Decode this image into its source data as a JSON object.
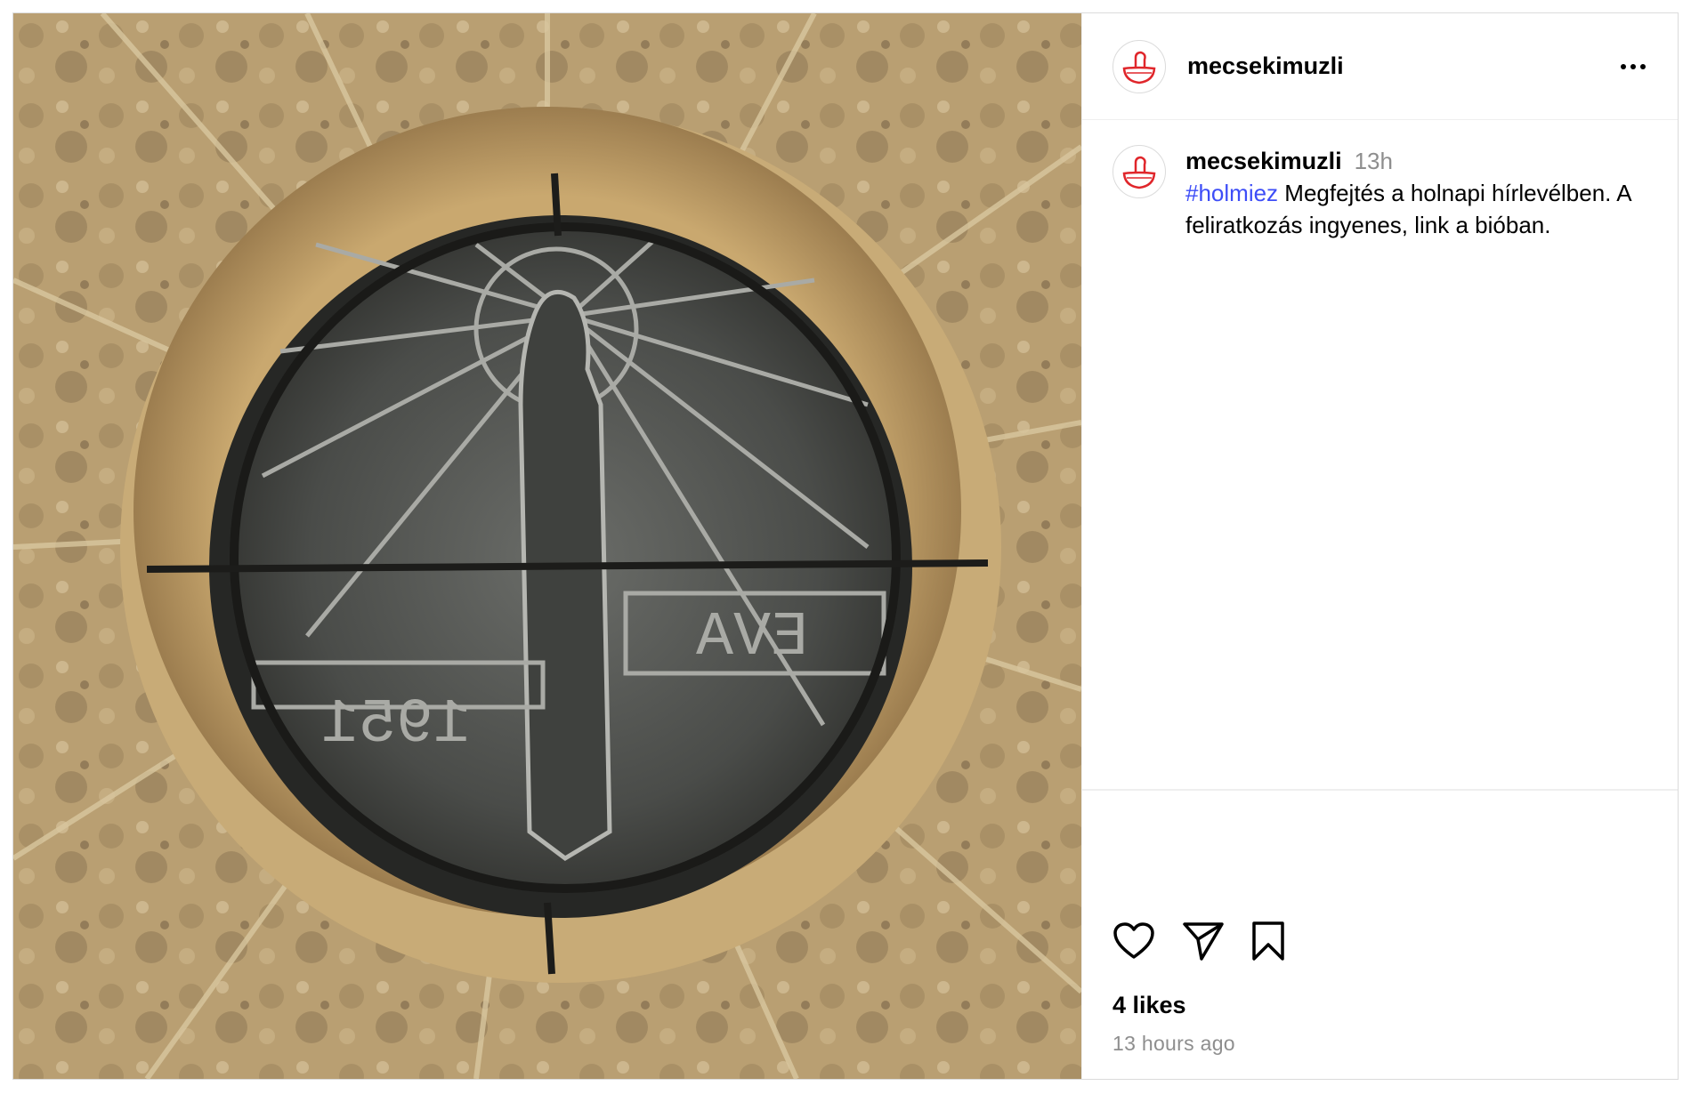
{
  "post": {
    "username": "mecsekimuzli",
    "image_alt": "Round window with metal grille of a figure with halo, inscription EVA and 1951, set in a stone wall"
  },
  "header": {
    "username": "mecsekimuzli",
    "more_icon": "more-horizontal-icon"
  },
  "caption": {
    "username": "mecsekimuzli",
    "time": "13h",
    "hashtag": "#holmiez",
    "text": " Megfejtés a holnapi hírlevélben. A feliratkozás ingyenes, link a bióban."
  },
  "actions": {
    "like_icon": "heart-icon",
    "share_icon": "paper-plane-icon",
    "save_icon": "bookmark-icon",
    "likes": "4 likes",
    "posted_ago": "13 hours ago"
  },
  "colors": {
    "hashtag": "#3d4df7",
    "secondary_text": "#8e8e8e",
    "brand_red": "#e0262b",
    "border": "#dbdbdb"
  }
}
